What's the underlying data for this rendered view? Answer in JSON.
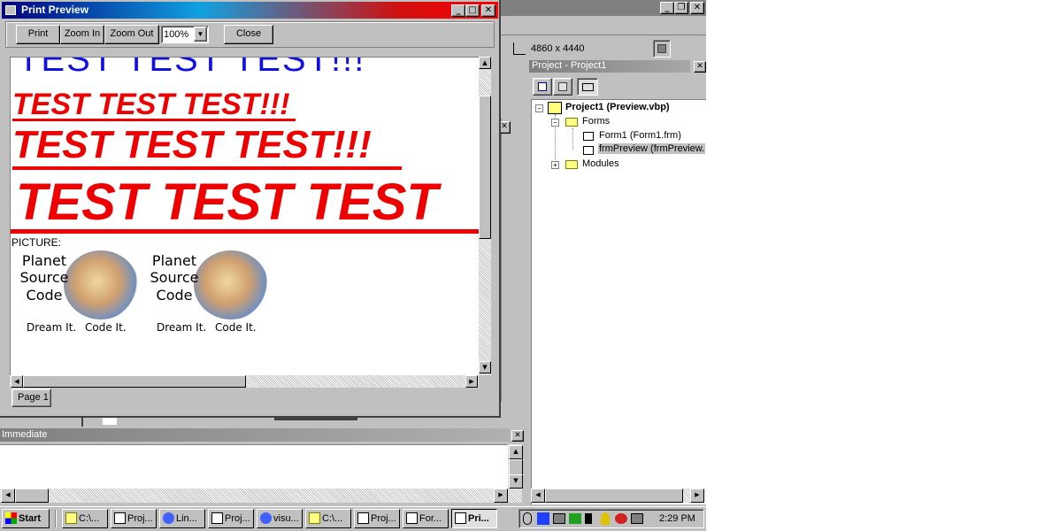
{
  "ide": {
    "size_readout": "4860 x 4440"
  },
  "preview": {
    "title": "Print Preview",
    "toolbar": {
      "print": "Print",
      "zoom_in": "Zoom In",
      "zoom_out": "Zoom Out",
      "zoom_value": "100%",
      "close": "Close"
    },
    "content": {
      "line1": "TEST TEST TEST!!!",
      "line2": "TEST TEST TEST!!!",
      "line3": "TEST TEST TEST!!!",
      "line4": "TEST TEST TEST",
      "picture_label": "PICTURE:",
      "logo": {
        "w1": "Planet",
        "w2": "Source",
        "w3": "Code",
        "tagline1": "Dream It.",
        "tagline2": "Code It."
      }
    },
    "page_tab": "Page 1"
  },
  "project": {
    "title": "Project - Project1",
    "root": "Project1 (Preview.vbp)",
    "forms_folder": "Forms",
    "form1": "Form1 (Form1.frm)",
    "form2": "frmPreview (frmPreview.",
    "modules_folder": "Modules"
  },
  "immediate": {
    "title": "Immediate"
  },
  "taskbar": {
    "start": "Start",
    "items": [
      "C:\\...",
      "Proj...",
      "Lin...",
      "Proj...",
      "visu...",
      "C:\\...",
      "Proj...",
      "For...",
      "Pri..."
    ],
    "clock": "2:29 PM"
  },
  "colors": {
    "title_active": "#000080",
    "title_inactive": "#808080",
    "preview_red": "#ee0000",
    "preview_blue": "#1010e0",
    "face": "#c0c0c0"
  }
}
